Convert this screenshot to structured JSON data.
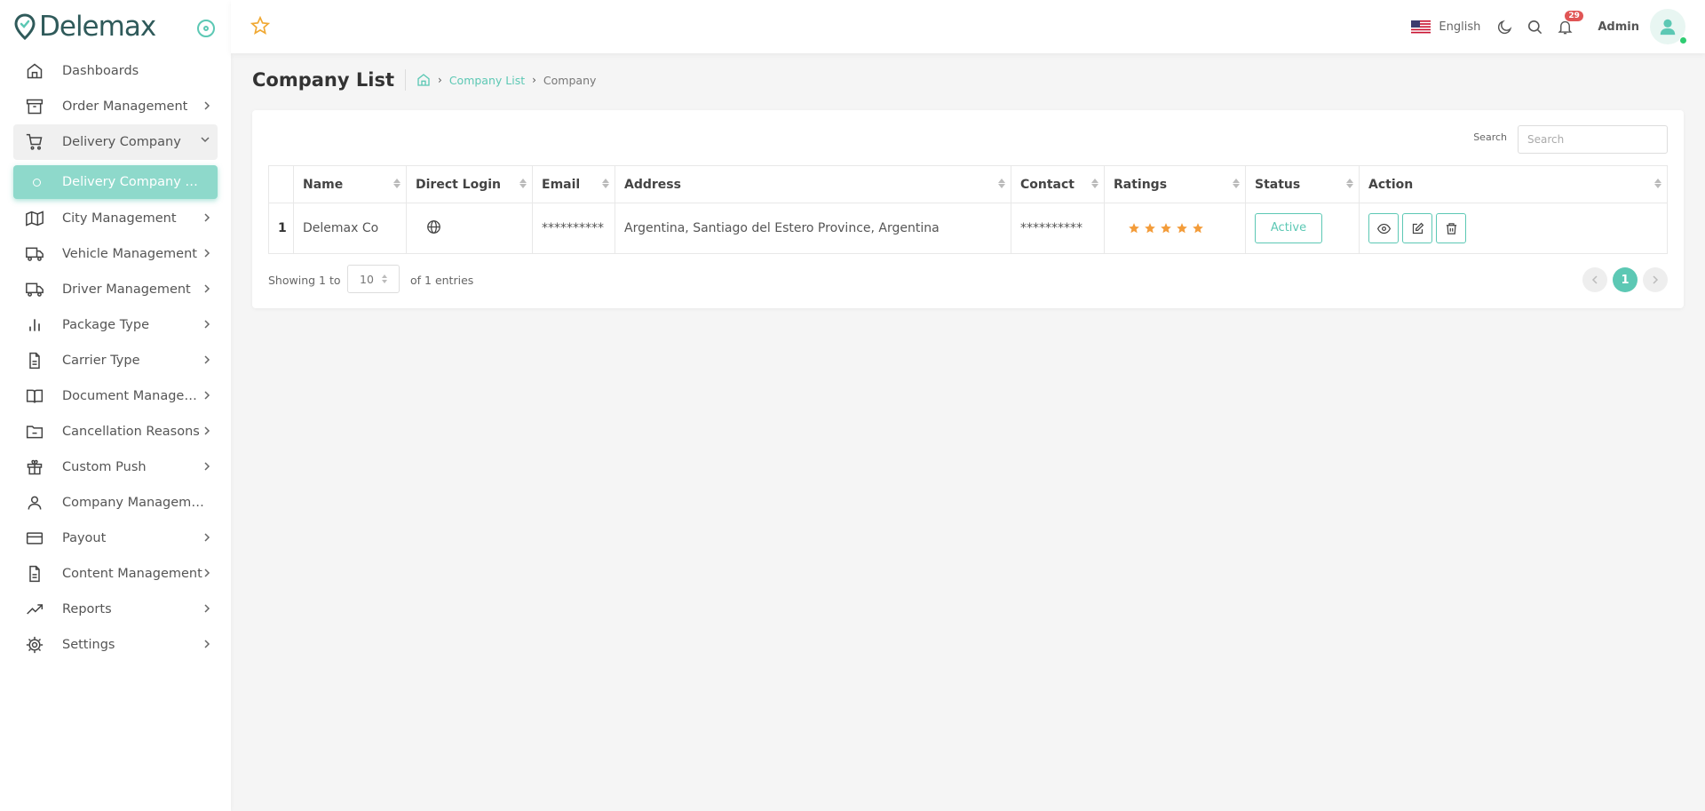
{
  "brand": {
    "name": "Delemax",
    "accent": "#5cc8b4"
  },
  "sidebar": {
    "items": [
      {
        "label": "Dashboards",
        "icon": "home-icon"
      },
      {
        "label": "Order Management",
        "icon": "archive-icon"
      },
      {
        "label": "Delivery Company",
        "icon": "cart-icon"
      },
      {
        "label": "Delivery Company List",
        "icon": "circle-icon"
      },
      {
        "label": "City Management",
        "icon": "map-icon"
      },
      {
        "label": "Vehicle Management",
        "icon": "truck-icon"
      },
      {
        "label": "Driver Management",
        "icon": "truck-icon"
      },
      {
        "label": "Package Type",
        "icon": "bar-chart-icon"
      },
      {
        "label": "Carrier Type",
        "icon": "document-icon"
      },
      {
        "label": "Document Manageme...",
        "icon": "book-icon"
      },
      {
        "label": "Cancellation Reasons",
        "icon": "folder-minus-icon"
      },
      {
        "label": "Custom Push",
        "icon": "gift-icon"
      },
      {
        "label": "Company Management",
        "icon": "user-icon"
      },
      {
        "label": "Payout",
        "icon": "credit-card-icon"
      },
      {
        "label": "Content Management",
        "icon": "document-icon"
      },
      {
        "label": "Reports",
        "icon": "trending-up-icon"
      },
      {
        "label": "Settings",
        "icon": "gear-icon"
      }
    ]
  },
  "header": {
    "language": "English",
    "notification_count": "29",
    "user_name": "Admin"
  },
  "page": {
    "title": "Company List",
    "breadcrumb": {
      "link": "Company List",
      "current": "Company"
    }
  },
  "search": {
    "label": "Search",
    "placeholder": "Search"
  },
  "table": {
    "columns": [
      "Name",
      "Direct Login",
      "Email",
      "Address",
      "Contact",
      "Ratings",
      "Status",
      "Action"
    ],
    "rows": [
      {
        "index": "1",
        "name": "Delemax Co",
        "email": "**********",
        "address": "Argentina, Santiago del Estero Province, Argentina",
        "contact": "**********",
        "rating": 5,
        "status": "Active"
      }
    ]
  },
  "pagination": {
    "showing_prefix": "Showing 1 to",
    "page_length": "10",
    "showing_suffix": "of 1 entries",
    "current_page": "1"
  }
}
